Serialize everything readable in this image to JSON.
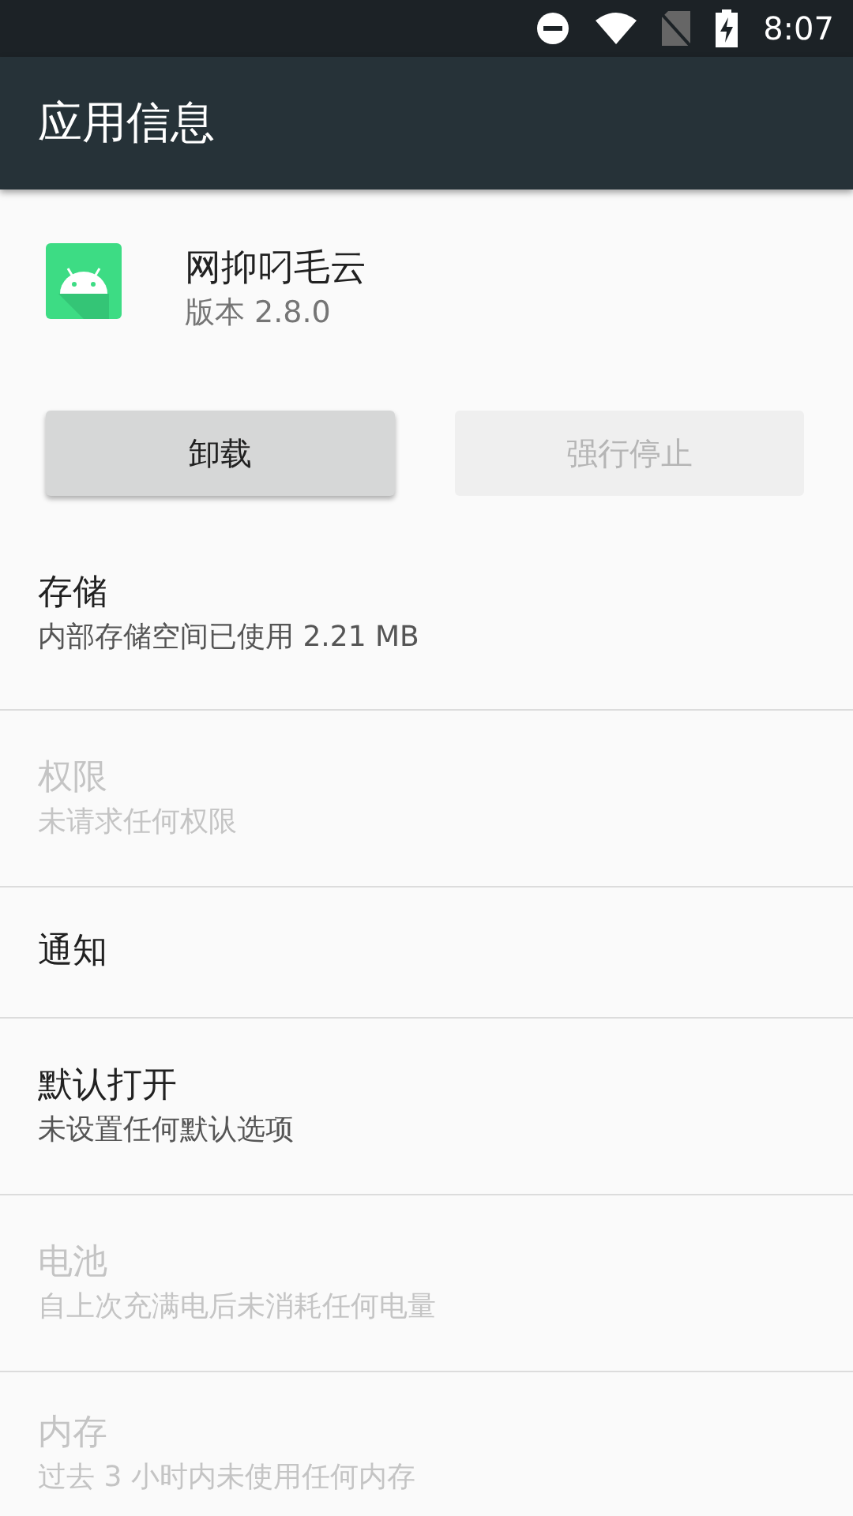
{
  "status_bar": {
    "time": "8:07"
  },
  "toolbar": {
    "title": "应用信息"
  },
  "app": {
    "name": "网抑叼毛云",
    "version": "版本 2.8.0"
  },
  "buttons": [
    {
      "label": "卸载",
      "disabled": false
    },
    {
      "label": "强行停止",
      "disabled": true
    }
  ],
  "settings": [
    {
      "title": "存储",
      "summary": "内部存储空间已使用 2.21 MB",
      "disabled": false
    },
    {
      "title": "权限",
      "summary": "未请求任何权限",
      "disabled": true
    },
    {
      "title": "通知",
      "disabled": false
    },
    {
      "title": "默认打开",
      "summary": "未设置任何默认选项",
      "disabled": false
    },
    {
      "title": "电池",
      "summary": "自上次充满电后未消耗任何电量",
      "disabled": true
    },
    {
      "title": "内存",
      "summary": "过去 3 小时内未使用任何内存",
      "disabled": true
    }
  ]
}
